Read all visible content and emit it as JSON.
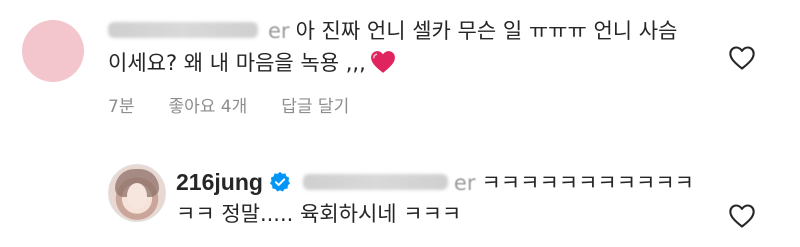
{
  "comments": [
    {
      "username_visible_tail": "er",
      "line1": "아 진짜 언니 셀카 무슨 일 ㅠㅠㅠ 언니 사슴",
      "line2": "이세요? 왜 내 마음을 녹용 ,,,",
      "emoji": "heart-icon",
      "meta": {
        "time": "7분",
        "likes": "좋아요 4개",
        "reply": "답글 달기"
      }
    },
    {
      "username": "216jung",
      "mention_visible_tail": "er",
      "line1": "ㅋㅋㅋㅋㅋㅋㅋㅋㅋㅋㅋ",
      "line2": "ㅋㅋ 정말..... 육회하시네 ㅋㅋㅋ"
    }
  ],
  "colors": {
    "text": "#262626",
    "meta": "#8e8e8e",
    "verified": "#0095f6",
    "heart": "#e0245e"
  }
}
